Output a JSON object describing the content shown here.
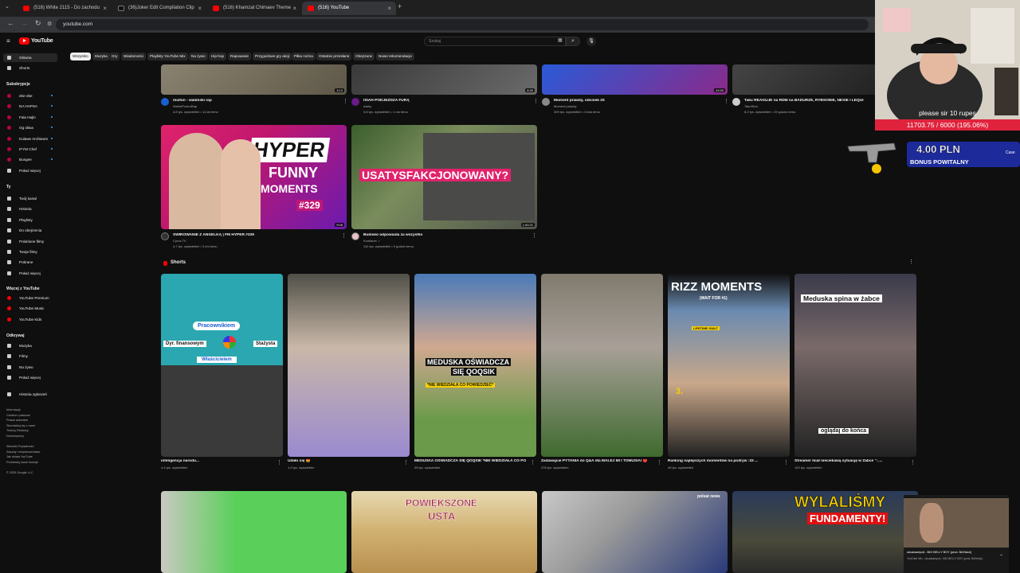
{
  "browser": {
    "tabs": [
      {
        "label": "(516) White 2115 - Do zachodu"
      },
      {
        "label": "(36)Joker Edit Compilation Clip"
      },
      {
        "label": "(516) Khamzat Chimaev Theme"
      },
      {
        "label": "(516) YouTube"
      }
    ],
    "url": "youtube.com"
  },
  "yt": {
    "logo": "YouTube",
    "search_placeholder": "Szukaj",
    "chips": [
      "Wszystko",
      "Muzyka",
      "Gry",
      "Wiadomości",
      "Playlisty YouTube Mix",
      "Na żywo",
      "Hip-hop",
      "Rapowanie",
      "Przygodowe gry akcji",
      "Piłka nożna",
      "Ostatnio przesłane",
      "Obejrzane",
      "Nowe rekomendacje"
    ]
  },
  "sidebar": {
    "main": [
      "Główna",
      "Shorts"
    ],
    "subs_heading": "Subskrypcje",
    "subs": [
      "ebe ebe",
      "NA HAPSA",
      "Fala Hajlo",
      "Og oliwa",
      "Kulawe Archiwum",
      "IFYM Chef",
      "Bungee",
      "Pokaż więcej"
    ],
    "you_heading": "Ty",
    "you": [
      "Twój kanał",
      "Historia",
      "Playlisty",
      "Do obejrzenia",
      "Polubione filmy",
      "Twoje filmy",
      "Pobrane",
      "Pokaż więcej"
    ],
    "more_heading": "Więcej z YouTube",
    "more": [
      "YouTube Premium",
      "YouTube Music",
      "YouTube Kids"
    ],
    "explore_heading": "Odkrywaj",
    "explore": [
      "Muzyka",
      "Filmy",
      "Na żywo",
      "Pokaż więcej"
    ],
    "report": "Historia zgłoszeń",
    "footer": [
      "Informacje",
      "Centrum prasowe",
      "Prawa autorskie",
      "Skontaktuj się z nami",
      "Twórcy  Reklamy",
      "Deweloperzy",
      "",
      "Warunki  Prywatność",
      "Zasady i bezpieczeństwo",
      "Jak działa YouTube",
      "Przetestuj nowe funkcje",
      "",
      "© 2025 Google LLC"
    ]
  },
  "row1": [
    {
      "title": "mullon - walimski rap",
      "channel": "WalimPromoRap",
      "stats": "4,8 tys. wyświetleń • 14 lat temu",
      "duration": "3:13"
    },
    {
      "title": "ISIAH PODJEŻDŻA FURĄ",
      "channel": "isiahy",
      "stats": "3,8 tys. wyświetleń • 1 rok temu",
      "duration": "8:30"
    },
    {
      "title": "Moment prawdy, odcinek 25",
      "channel": "Moment prawdy",
      "stats": "309 tys. wyświetleń • 4 lata temu",
      "duration": "43:55"
    },
    {
      "title": "Taku REAGUJE na RDM na BADURZE, RYBSONIE, NEXIE I LEQUI",
      "channel": "TakuShot",
      "stats": "8,2 tys. wyświetleń • 19 godzin temu",
      "duration": ""
    }
  ],
  "row2": [
    {
      "title": "ŚWIROWANIE Z ANGELKĄ | FM HYPER #329",
      "channel": "Cyrus TV",
      "stats": "4,7 tys. wyświetleń • 3 dni temu",
      "duration": "9:06",
      "thumb_lines": [
        "HYPER",
        "FUNNY",
        "MOMENTS",
        "#329"
      ]
    },
    {
      "title": "Budowo odpowiada za wszystko",
      "channel": "Konfiarze ✓",
      "stats": "110 tys. wyświetleń • 9 godzin temu",
      "duration": "1:00:21",
      "thumb_lines": [
        "USATYSFAKCJONOWANY?"
      ]
    }
  ],
  "shorts": {
    "heading": "Shorts",
    "items": [
      {
        "title": "inteligencja narodu...",
        "views": "4,4 tys. wyświetleń",
        "thumb_lines": [
          "Pracownikiem",
          "Dyr. finansowym",
          "Stażysta",
          "Właścicielem"
        ]
      },
      {
        "title": "Udało się 😍",
        "views": "1,9 tys. wyświetleń",
        "thumb_lines": []
      },
      {
        "title": "MEDUSKA OŚWIADCZA SIĘ QOQSIK *NIE WIEDZIAŁA CO POWIEDZIEĆ*",
        "views": "25 tys. wyświetleń",
        "thumb_lines": [
          "MEDUSKA OŚWIADCZA",
          "SIĘ QOQSIK",
          "*NIE WIEDZIAŁA CO POWIEDZIEĆ*"
        ]
      },
      {
        "title": "Zadawajcie PYTANIA do Q&A dla MALEJ MI I TOMUSIA! 🔴",
        "views": "378 tys. wyświetleń",
        "thumb_lines": []
      },
      {
        "title": "Ranking najlepszych momentów na podryw :33 ...",
        "views": "49 tys. wyświetleń",
        "thumb_lines": [
          "RIZZ MOMENTS",
          "(WAIT FOR #1)",
          "LIFETIME GUILT",
          "3."
        ]
      },
      {
        "title": "Streamer miał nieciekawą sytuację w Żabce 🔨...",
        "views": "100 tys. wyświetleń",
        "thumb_lines": [
          "Meduska spina w żabce",
          "oglądaj do końca"
        ]
      }
    ]
  },
  "row3": [
    {
      "thumb_lines": []
    },
    {
      "thumb_lines": [
        "POWIĘKSZONE",
        "USTA"
      ]
    },
    {
      "thumb_lines": [
        "polsat news"
      ]
    },
    {
      "thumb_lines": [
        "WYLALIŚMY",
        "FUNDAMENTY!"
      ]
    }
  ],
  "overlay": {
    "message": "please sir 10 rupes",
    "goal": "11703.75 / 6000 (195.06%)",
    "bonus_amount": "4.00 PLN",
    "bonus_label": "BONUS POWITALNY",
    "bonus_side": "Case",
    "miniplayer_title": "ukcaluampoil - BIG BELLY BOY (prod. BAHsick)",
    "miniplayer_sub": "YouTube Mix - ukcaluampoil - BIG BELLY BOY (prod. BAHsick)"
  },
  "colors": {
    "bg": "#0f0f0f",
    "accent": "#ff0000",
    "chip": "#272727",
    "goal_bar": "#e0233c",
    "bonus": "#1c2a9a"
  }
}
